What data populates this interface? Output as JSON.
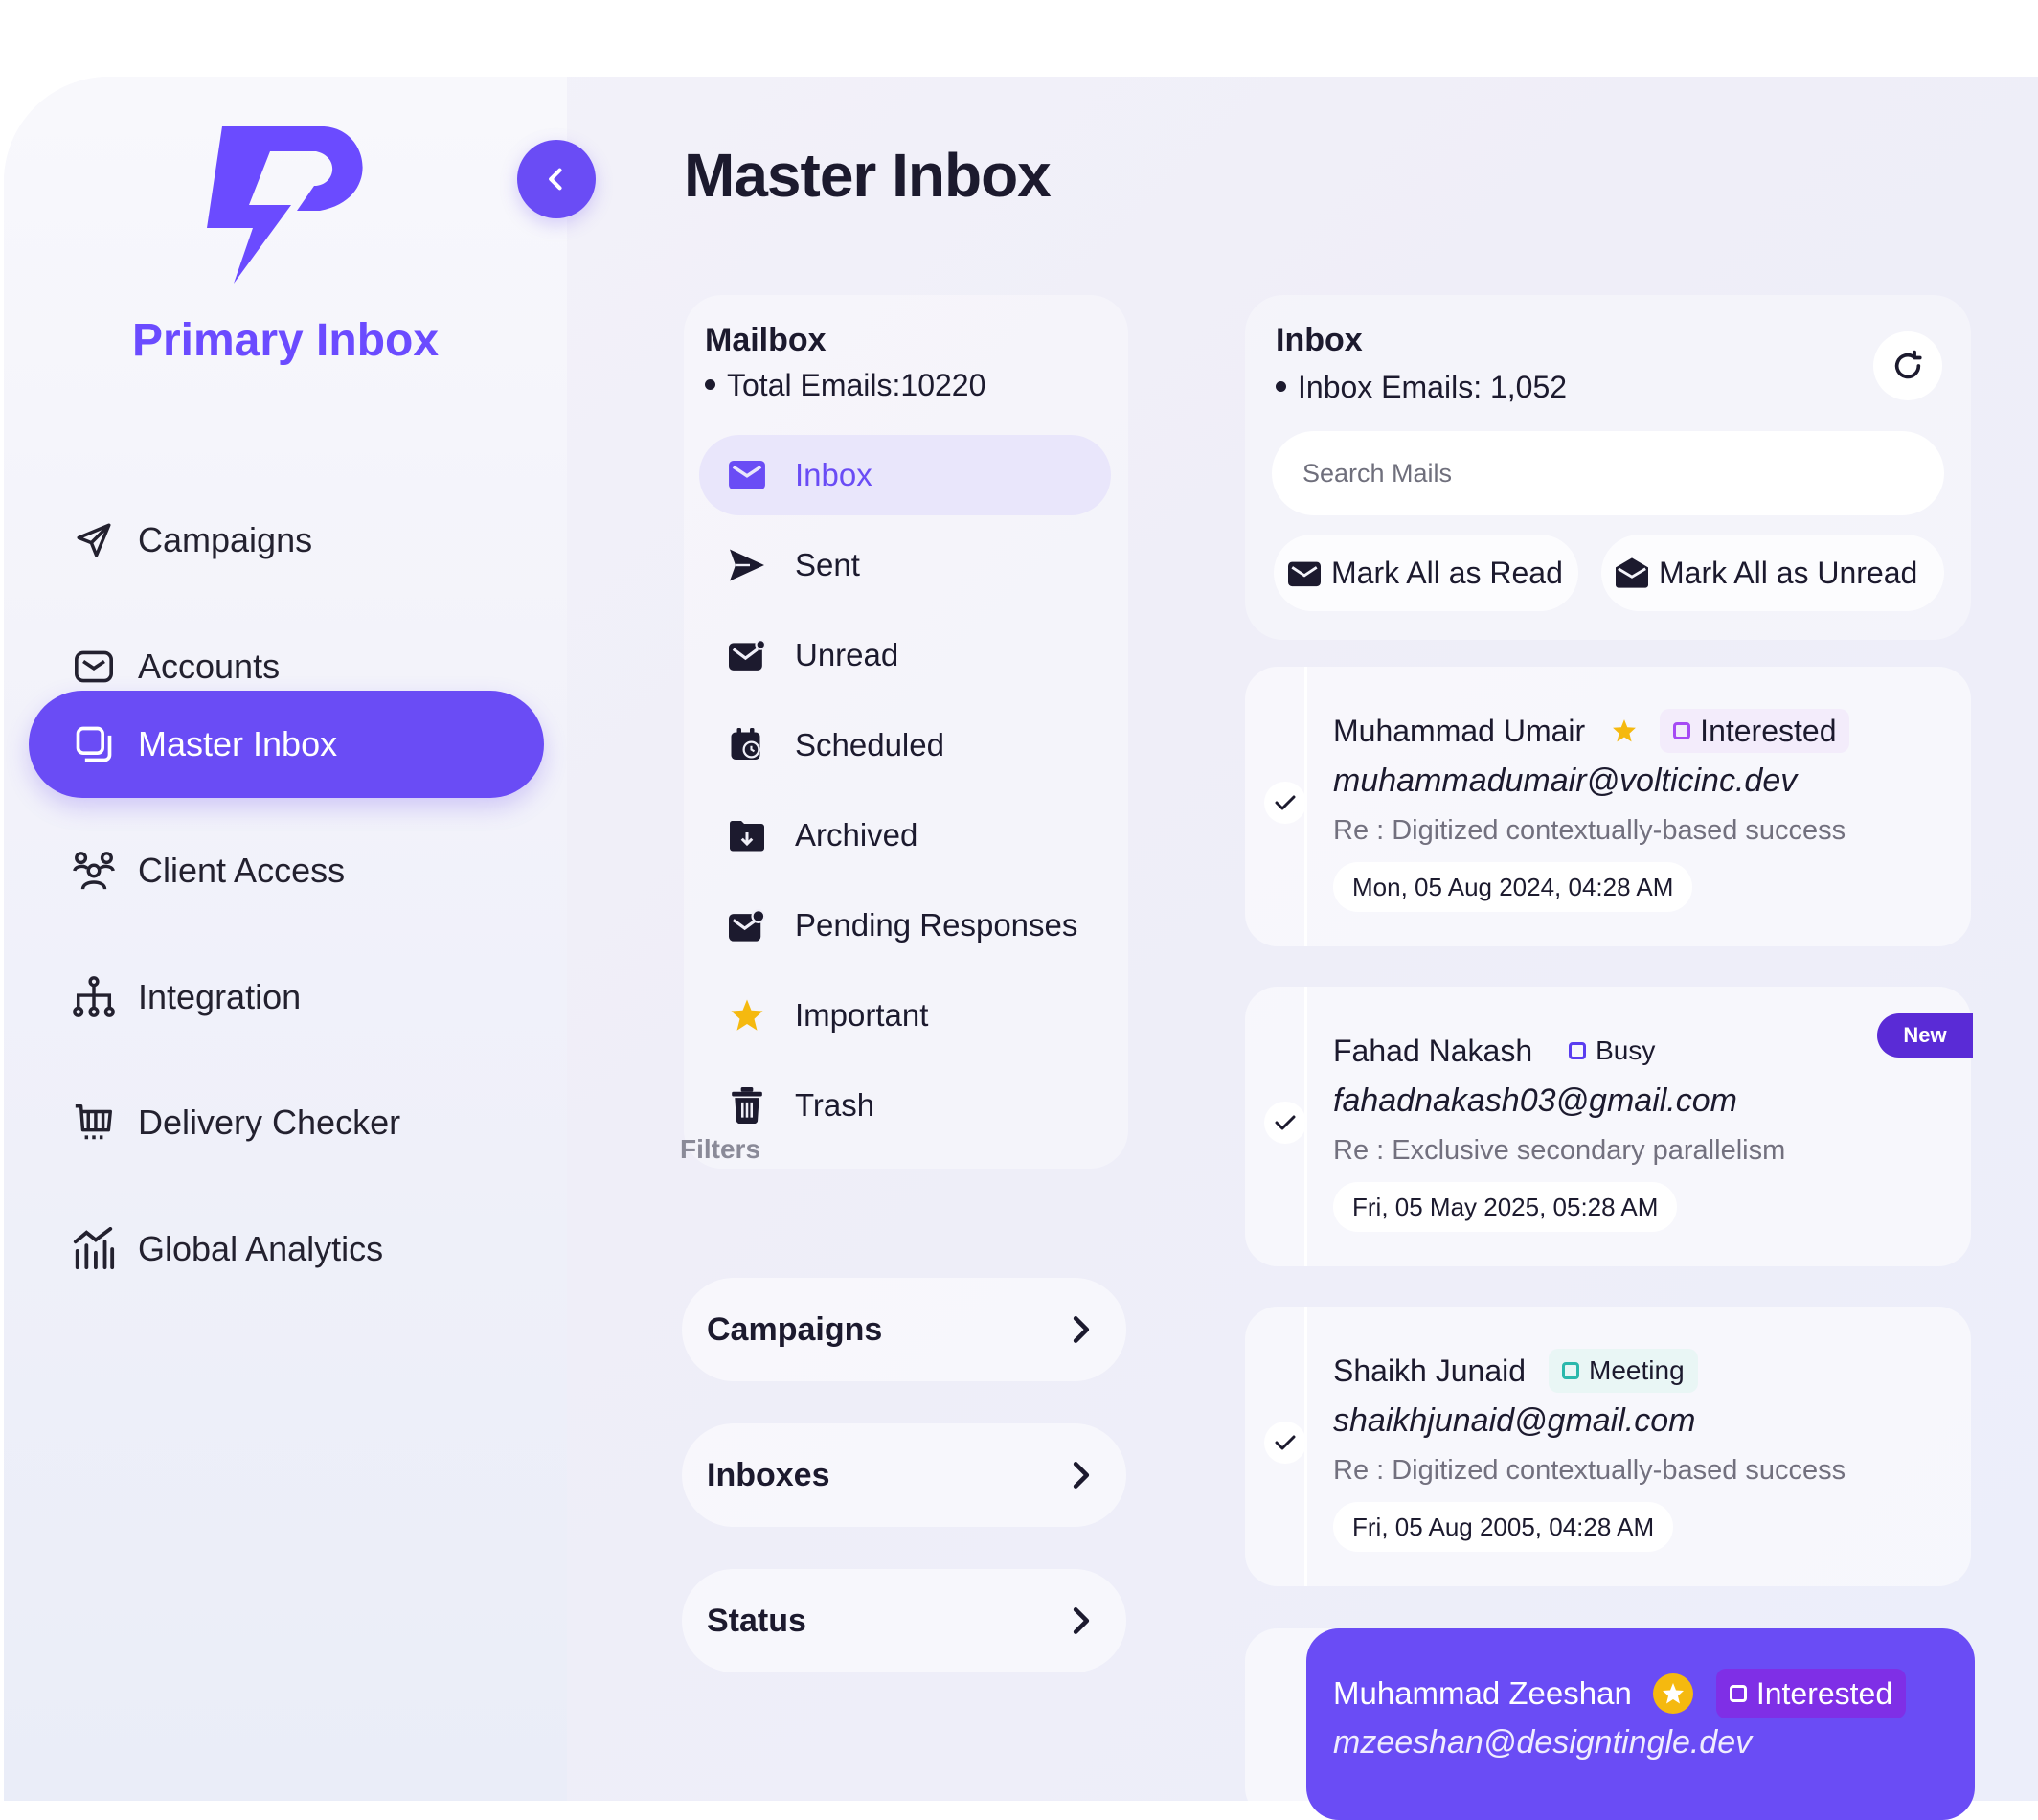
{
  "sidebar": {
    "brand": "Primary Inbox",
    "items": [
      {
        "label": "Campaigns",
        "icon": "send-icon"
      },
      {
        "label": "Accounts",
        "icon": "mail-icon"
      },
      {
        "label": "Master Inbox",
        "icon": "inbox-copy-icon",
        "active": true
      },
      {
        "label": "Client Access",
        "icon": "users-icon"
      },
      {
        "label": "Integration",
        "icon": "hierarchy-icon"
      },
      {
        "label": "Delivery Checker",
        "icon": "cart-icon"
      },
      {
        "label": "Global Analytics",
        "icon": "bar-chart-icon"
      }
    ]
  },
  "page": {
    "title": "Master Inbox"
  },
  "mailbox": {
    "title": "Mailbox",
    "total": "Total Emails:10220",
    "folders": [
      {
        "label": "Inbox",
        "active": true
      },
      {
        "label": "Sent"
      },
      {
        "label": "Unread"
      },
      {
        "label": "Scheduled"
      },
      {
        "label": "Archived"
      },
      {
        "label": "Pending Responses"
      },
      {
        "label": "Important"
      },
      {
        "label": "Trash"
      }
    ]
  },
  "filters": {
    "label": "Filters",
    "items": [
      "Campaigns",
      "Inboxes",
      "Status"
    ]
  },
  "inbox": {
    "title": "Inbox",
    "count": "Inbox Emails: 1,052",
    "search_placeholder": "Search Mails",
    "mark_read": "Mark All as Read",
    "mark_unread": "Mark All as Unread"
  },
  "emails": [
    {
      "name": "Muhammad Umair",
      "starred": true,
      "tag": "Interested",
      "email": "muhammadumair@volticinc.dev",
      "subject": "Re : Digitized contextually-based success",
      "date": "Mon, 05 Aug 2024, 04:28 AM"
    },
    {
      "name": "Fahad Nakash",
      "tag": "Busy",
      "badge": "New",
      "email": "fahadnakash03@gmail.com",
      "subject": "Re : Exclusive secondary parallelism",
      "date": "Fri, 05 May 2025, 05:28 AM"
    },
    {
      "name": "Shaikh Junaid",
      "tag": "Meeting",
      "email": "shaikhjunaid@gmail.com",
      "subject": "Re : Digitized contextually-based success",
      "date": "Fri, 05 Aug 2005, 04:28 AM"
    },
    {
      "name": "Muhammad Zeeshan",
      "starred": true,
      "tag": "Interested",
      "email": "mzeeshan@designtingle.dev"
    }
  ],
  "colors": {
    "accent": "#6a4cf5",
    "star": "#f5b90f",
    "badge": "#5a2bd6"
  }
}
